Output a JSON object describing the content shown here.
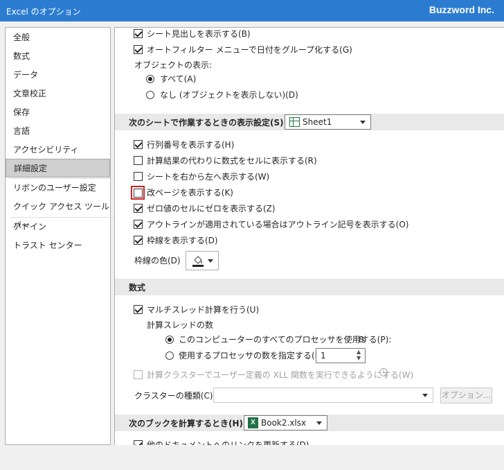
{
  "window": {
    "title": "Excel のオプション",
    "brand": "Buzzword Inc."
  },
  "sidebar": {
    "items": [
      {
        "label": "全般"
      },
      {
        "label": "数式"
      },
      {
        "label": "データ"
      },
      {
        "label": "文章校正"
      },
      {
        "label": "保存"
      },
      {
        "label": "言語"
      },
      {
        "label": "アクセシビリティ"
      },
      {
        "label": "詳細設定",
        "selected": true
      },
      {
        "label": "リボンのユーザー設定"
      },
      {
        "label": "クイック アクセス ツール バー"
      },
      {
        "label": "アドイン"
      },
      {
        "label": "トラスト センター"
      }
    ]
  },
  "display_workbook": {
    "show_sheet_tabs": {
      "label": "シート見出しを表示する(B)",
      "checked": true
    },
    "group_dates": {
      "label": "オートフィルター メニューで日付をグループ化する(G)",
      "checked": true
    },
    "objects_label": "オブジェクトの表示:",
    "obj_all": {
      "label": "すべて(A)",
      "selected": true
    },
    "obj_none": {
      "label": "なし (オブジェクトを表示しない)(D)",
      "selected": false
    }
  },
  "display_sheet": {
    "section_title": "次のシートで作業するときの表示設定(S):",
    "sheet_value": "Sheet1",
    "show_headers": {
      "label": "行列番号を表示する(H)",
      "checked": true
    },
    "show_formulas": {
      "label": "計算結果の代わりに数式をセルに表示する(R)",
      "checked": false
    },
    "right_to_left": {
      "label": "シートを右から左へ表示する(W)",
      "checked": false
    },
    "page_breaks": {
      "label": "改ページを表示する(K)",
      "checked": false
    },
    "zero_values": {
      "label": "ゼロ値のセルにゼロを表示する(Z)",
      "checked": true
    },
    "outline_symbols": {
      "label": "アウトラインが適用されている場合はアウトライン記号を表示する(O)",
      "checked": true
    },
    "gridlines": {
      "label": "枠線を表示する(D)",
      "checked": true
    },
    "grid_color_label": "枠線の色(D)"
  },
  "formulas": {
    "section_title": "数式",
    "multithread": {
      "label": "マルチスレッド計算を行う(U)",
      "checked": true
    },
    "threads_label": "計算スレッドの数",
    "use_all": {
      "label": "このコンピューターのすべてのプロセッサを使用する(P):",
      "value": "8",
      "selected": true
    },
    "manual": {
      "label": "使用するプロセッサの数を指定する(M):",
      "value": "1",
      "selected": false
    },
    "cluster": {
      "label": "計算クラスターでユーザー定義の XLL 関数を実行できるようにする(W)",
      "checked": false
    },
    "cluster_type_label": "クラスターの種類(C):",
    "options_button": "オプション..."
  },
  "workbook_calc": {
    "section_title": "次のブックを計算するとき(H):",
    "book_value": "Book2.xlsx",
    "update_links": {
      "label": "他のドキュメントへのリンクを更新する(D)",
      "checked": true
    }
  }
}
